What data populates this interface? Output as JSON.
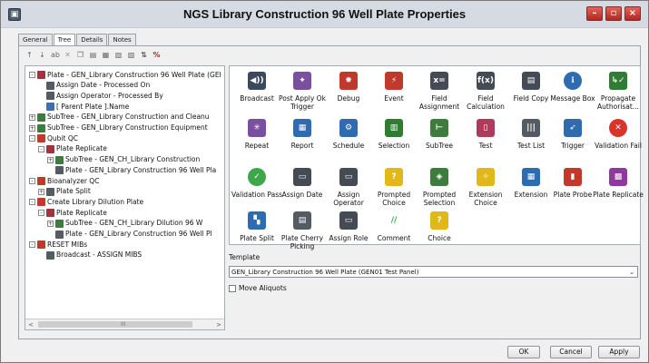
{
  "window": {
    "title": "NGS Library Construction 96 Well Plate Properties"
  },
  "window_buttons": {
    "minimize": "–",
    "maximize": "▫",
    "close": "×"
  },
  "tabs": [
    {
      "label": "General",
      "active": false
    },
    {
      "label": "Tree",
      "active": true
    },
    {
      "label": "Details",
      "active": false
    },
    {
      "label": "Notes",
      "active": false
    }
  ],
  "tree": {
    "items": [
      {
        "label": "Plate - GEN_Library Construction 96 Well Plate (GEI",
        "icon": "plate-icon",
        "color": "#a0333d"
      },
      {
        "label": "Assign Date - Processed On",
        "icon": "assign-date-icon",
        "color": "#555b63"
      },
      {
        "label": "Assign Operator - Processed By",
        "icon": "assign-operator-icon",
        "color": "#555b63"
      },
      {
        "label": "[ Parent Plate ].Name",
        "icon": "parent-plate-icon",
        "color": "#3f6fb2"
      },
      {
        "label": "SubTree - GEN_Library Construction and Cleanu",
        "icon": "subtree-icon",
        "color": "#3e7c3e"
      },
      {
        "label": "SubTree - GEN_Library Construction Equipment",
        "icon": "subtree-icon",
        "color": "#3e7c3e"
      },
      {
        "label": "Qubit QC",
        "icon": "event-icon",
        "color": "#c0392b"
      },
      {
        "label": "Plate Replicate",
        "icon": "plate-replicate-icon",
        "color": "#a0333d"
      },
      {
        "label": "SubTree - GEN_CH_Library Construction",
        "icon": "subtree-icon",
        "color": "#3e7c3e"
      },
      {
        "label": "Plate - GEN_Library Construction 96 Well Pla",
        "icon": "plate-icon",
        "color": "#555b63"
      },
      {
        "label": "Bioanalyzer QC",
        "icon": "event-icon",
        "color": "#c0392b"
      },
      {
        "label": "Plate Split",
        "icon": "plate-split-icon",
        "color": "#555b63"
      },
      {
        "label": "Create Library Dilution Plate",
        "icon": "event-icon",
        "color": "#c0392b"
      },
      {
        "label": "Plate Replicate",
        "icon": "plate-replicate-icon",
        "color": "#a0333d"
      },
      {
        "label": "SubTree - GEN_CH_Library Dilution 96 W",
        "icon": "subtree-icon",
        "color": "#3e7c3e"
      },
      {
        "label": "Plate - GEN_Library Construction 96 Well Pl",
        "icon": "plate-icon",
        "color": "#555b63"
      },
      {
        "label": "RESET MIBs",
        "icon": "event-icon",
        "color": "#c0392b"
      },
      {
        "label": "Broadcast - ASSIGN MIBS",
        "icon": "broadcast-icon",
        "color": "#555b63"
      }
    ],
    "scroll_left": "<",
    "scroll_right": ">",
    "scroll_grip": "III"
  },
  "palette": {
    "items": [
      {
        "label": "Broadcast",
        "icon": "broadcast-icon",
        "color": "#3a4a5c"
      },
      {
        "label": "Post Apply Ok Trigger",
        "icon": "post-apply-trigger-icon",
        "color": "#7a4fa0"
      },
      {
        "label": "Debug",
        "icon": "debug-icon",
        "color": "#c0392b"
      },
      {
        "label": "Event",
        "icon": "event-icon",
        "color": "#c0392b"
      },
      {
        "label": "Field Assignment",
        "icon": "field-assignment-icon",
        "color": "#444b55"
      },
      {
        "label": "Field Calculation",
        "icon": "field-calculation-icon",
        "color": "#444b55"
      },
      {
        "label": "Field Copy",
        "icon": "field-copy-icon",
        "color": "#444b55"
      },
      {
        "label": "Message Box",
        "icon": "message-box-icon",
        "color": "#2f6bb0"
      },
      {
        "label": "Propagate Authorisat...",
        "icon": "propagate-authorisation-icon",
        "color": "#2e7d32"
      },
      {
        "label": "Repeat",
        "icon": "repeat-icon",
        "color": "#7a4fa0"
      },
      {
        "label": "Report",
        "icon": "report-icon",
        "color": "#2f6bb0"
      },
      {
        "label": "Schedule",
        "icon": "schedule-icon",
        "color": "#2f6bb0"
      },
      {
        "label": "Selection",
        "icon": "selection-icon",
        "color": "#2e7d32"
      },
      {
        "label": "SubTree",
        "icon": "subtree-icon",
        "color": "#3e7c3e"
      },
      {
        "label": "Test",
        "icon": "test-icon",
        "color": "#b03a5b"
      },
      {
        "label": "Test List",
        "icon": "test-list-icon",
        "color": "#555b63"
      },
      {
        "label": "Trigger",
        "icon": "trigger-icon",
        "color": "#2f6bb0"
      },
      {
        "label": "Validation Fail",
        "icon": "validation-fail-icon",
        "color": "#d9342b"
      },
      {
        "label": "Validation Pass",
        "icon": "validation-pass-icon",
        "color": "#3fa64a"
      },
      {
        "label": "Assign Date",
        "icon": "assign-date-icon",
        "color": "#444b55"
      },
      {
        "label": "Assign Operator",
        "icon": "assign-operator-icon",
        "color": "#444b55"
      },
      {
        "label": "Prompted Choice",
        "icon": "prompted-choice-icon",
        "color": "#e0b81a"
      },
      {
        "label": "Prompted Selection",
        "icon": "prompted-selection-icon",
        "color": "#3e7c3e"
      },
      {
        "label": "Extension Choice",
        "icon": "extension-choice-icon",
        "color": "#e0b81a"
      },
      {
        "label": "Extension",
        "icon": "extension-icon",
        "color": "#2f6bb0"
      },
      {
        "label": "Plate Probe",
        "icon": "plate-probe-icon",
        "color": "#c0392b"
      },
      {
        "label": "Plate Replicate",
        "icon": "plate-replicate-icon",
        "color": "#8e3a9d"
      },
      {
        "label": "Plate Split",
        "icon": "plate-split-icon",
        "color": "#2f6bb0"
      },
      {
        "label": "Plate Cherry Picking",
        "icon": "plate-cherry-picking-icon",
        "color": "#555b63"
      },
      {
        "label": "Assign Role",
        "icon": "assign-role-icon",
        "color": "#444b55"
      },
      {
        "label": "Comment",
        "icon": "comment-icon",
        "color": "#3fa64a"
      },
      {
        "label": "Choice",
        "icon": "choice-icon",
        "color": "#e0b81a"
      }
    ]
  },
  "template": {
    "label": "Template",
    "value": "GEN_Library Construction 96 Well Plate (GEN01 Test Panel)"
  },
  "move_aliquots": {
    "label": "Move Aliquots",
    "checked": false
  },
  "buttons": {
    "ok": "OK",
    "cancel": "Cancel",
    "apply": "Apply"
  }
}
